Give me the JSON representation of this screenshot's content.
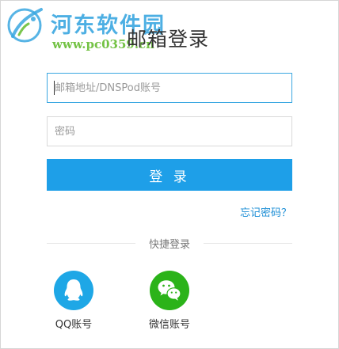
{
  "watermark": {
    "site_name": "河东软件园",
    "site_url": "www.pc0359.cn"
  },
  "page": {
    "title": "邮箱登录"
  },
  "form": {
    "email_placeholder": "邮箱地址/DNSPod账号",
    "password_placeholder": "密码",
    "login_label": "登 录",
    "forgot_label": "忘记密码？"
  },
  "quick_login": {
    "divider_label": "快捷登录",
    "options": [
      {
        "label": "QQ账号",
        "icon": "qq-icon",
        "color": "#1ea7e6"
      },
      {
        "label": "微信账号",
        "icon": "wechat-icon",
        "color": "#2bb319"
      }
    ]
  },
  "colors": {
    "accent": "#1e9fe8",
    "link": "#1e8fd6",
    "focus_border": "#3aa7e1",
    "watermark_blue": "#3aa7e1",
    "watermark_green": "#6cbf3a"
  }
}
